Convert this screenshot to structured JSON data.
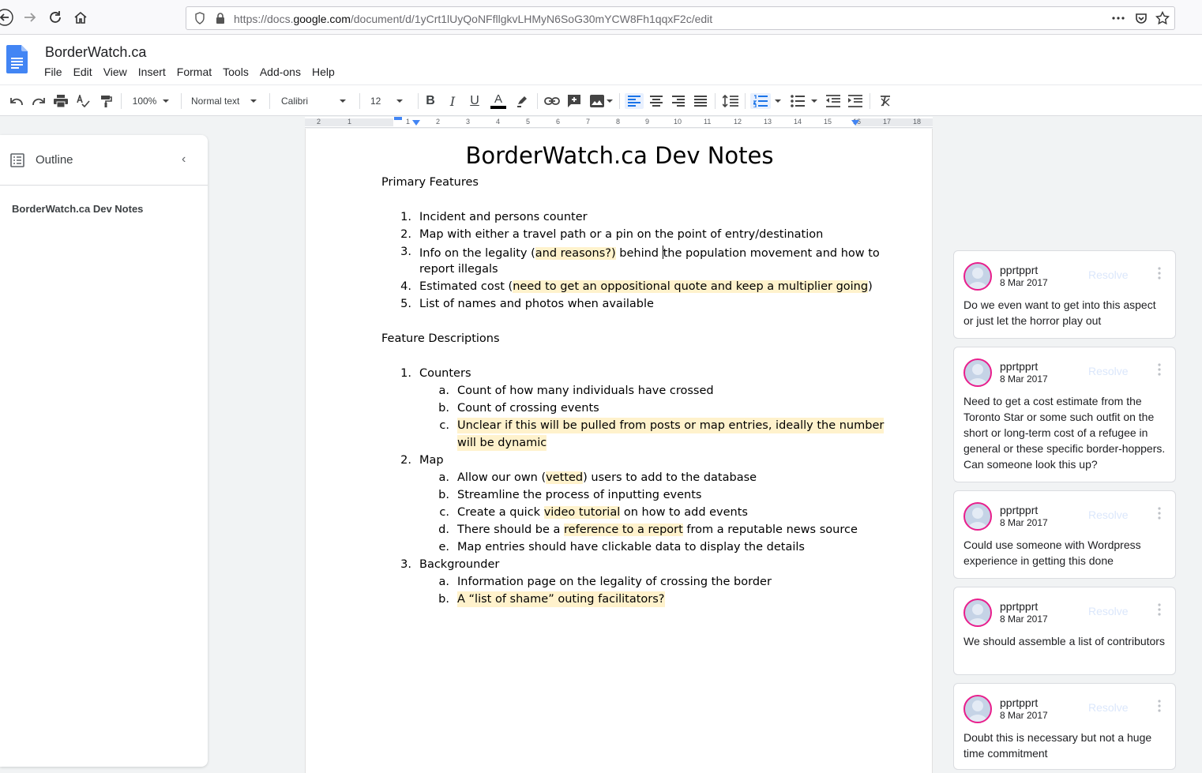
{
  "browser": {
    "url_prefix": "https://docs.",
    "url_domain": "google.com",
    "url_path": "/document/d/1yCrt1lUyQoNFfllgkvLHMyN6SoG30mYCW8Fh1qqxF2c/edit"
  },
  "header": {
    "title": "BorderWatch.ca",
    "menu": [
      "File",
      "Edit",
      "View",
      "Insert",
      "Format",
      "Tools",
      "Add-ons",
      "Help"
    ]
  },
  "toolbar": {
    "zoom": "100%",
    "style": "Normal text",
    "font": "Calibri",
    "size": "12"
  },
  "ruler": {
    "numbers": [
      "2",
      "1",
      "1",
      "2",
      "3",
      "4",
      "5",
      "6",
      "7",
      "8",
      "9",
      "10",
      "11",
      "12",
      "13",
      "14",
      "15",
      "16",
      "17",
      "18"
    ]
  },
  "outline": {
    "label": "Outline",
    "entry": "BorderWatch.ca Dev Notes"
  },
  "document": {
    "title": "BorderWatch.ca Dev Notes",
    "section1": "Primary Features",
    "primary": [
      {
        "n": "1.",
        "text": "Incident and persons counter"
      },
      {
        "n": "2.",
        "text": "Map with either a travel path or a pin on the point of entry/destination"
      },
      {
        "n": "3.",
        "a": "Info on the legality (",
        "hl": "and reasons?)",
        "b": " behind ",
        "c": "the population movement and how to",
        "line2": "report illegals"
      },
      {
        "n": "4.",
        "a": "Estimated cost (",
        "hl": "need to get an oppositional quote and keep a multiplier going",
        "b": ")"
      },
      {
        "n": "5.",
        "text": "List of names and photos when available"
      }
    ],
    "section2": "Feature Descriptions",
    "features": {
      "counters": {
        "n": "1.",
        "title": "Counters",
        "items": [
          {
            "n": "a.",
            "text": "Count of how many individuals have crossed"
          },
          {
            "n": "b.",
            "text": "Count of crossing events"
          },
          {
            "n": "c.",
            "hl1": "Unclear if this will be pulled from posts or map entries, ideally the number",
            "hl2": "will be dynamic"
          }
        ]
      },
      "map": {
        "n": "2.",
        "title": "Map",
        "items": [
          {
            "n": "a.",
            "a": "Allow our own (",
            "hl": "vetted",
            "b": ") users to add to the database"
          },
          {
            "n": "b.",
            "text": "Streamline the process of inputting events"
          },
          {
            "n": "c.",
            "a": "Create a quick ",
            "hl": "video tutorial",
            "b": " on how to add events"
          },
          {
            "n": "d.",
            "a": "There should be a ",
            "hl": "reference to a report",
            "b": " from a reputable news source"
          },
          {
            "n": "e.",
            "text": "Map entries should have clickable data to display the details"
          }
        ]
      },
      "backgrounder": {
        "n": "3.",
        "title": "Backgrounder",
        "items": [
          {
            "n": "a.",
            "text": "Information page on the legality of crossing the border"
          },
          {
            "n": "b.",
            "hl": "A “list of shame” outing facilitators?"
          }
        ]
      }
    }
  },
  "comments": [
    {
      "author": "pprtpprt",
      "date": "8 Mar 2017",
      "resolve": "Resolve",
      "body": "Do we even want to get into this aspect or just let the horror play out"
    },
    {
      "author": "pprtpprt",
      "date": "8 Mar 2017",
      "resolve": "Resolve",
      "body": "Need to get a cost estimate from the Toronto Star or some such outfit on the short or long-term cost of a refugee in general or these specific border-hoppers. Can someone look this up?"
    },
    {
      "author": "pprtpprt",
      "date": "8 Mar 2017",
      "resolve": "Resolve",
      "body": "Could use someone with Wordpress experience in getting this done"
    },
    {
      "author": "pprtpprt",
      "date": "8 Mar 2017",
      "resolve": "Resolve",
      "body": "We should assemble a list of contributors"
    },
    {
      "author": "pprtpprt",
      "date": "8 Mar 2017",
      "resolve": "Resolve",
      "body": "Doubt this is necessary but not a huge time commitment"
    }
  ]
}
